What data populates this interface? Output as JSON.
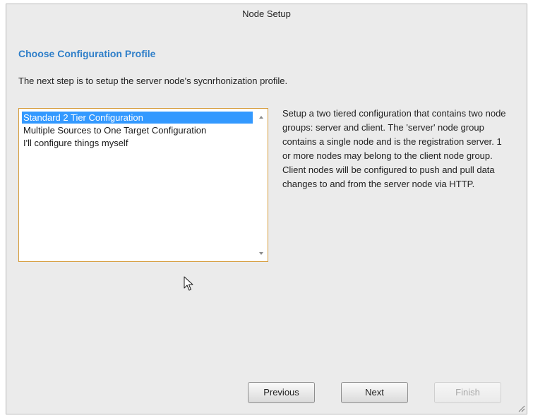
{
  "window": {
    "title": "Node Setup"
  },
  "page": {
    "heading": "Choose Configuration Profile",
    "intro": "The next step is to setup the server node's sycnrhonization profile."
  },
  "profiles": {
    "items": [
      {
        "label": "Standard 2 Tier Configuration",
        "selected": true
      },
      {
        "label": "Multiple Sources to One Target Configuration",
        "selected": false
      },
      {
        "label": "I'll configure things myself",
        "selected": false
      }
    ],
    "description": "Setup a two tiered configuration that contains two node groups: server and client. The 'server' node group contains a single node and is the registration server. 1 or more nodes may belong to the client node group. Client nodes will be configured to push and pull data changes to and from the server node via HTTP."
  },
  "buttons": {
    "previous": "Previous",
    "next": "Next",
    "finish": "Finish",
    "finish_enabled": false
  },
  "colors": {
    "heading": "#2f7fc9",
    "selection": "#3399ff",
    "listbox_border": "#d59c3c",
    "window_background": "#ebebeb"
  },
  "icons": [
    "mouse-pointer-icon",
    "resize-grip-icon",
    "scroll-up-arrow-icon",
    "scroll-down-arrow-icon"
  ]
}
